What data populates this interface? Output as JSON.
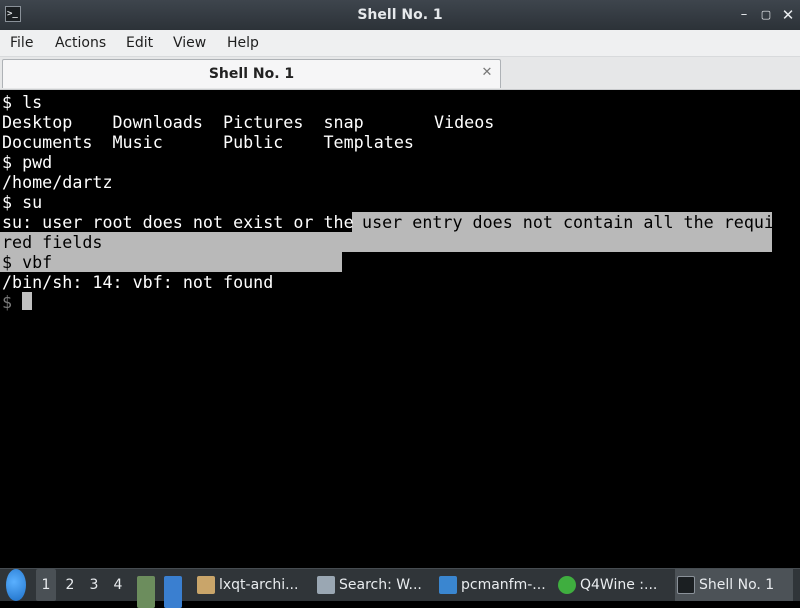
{
  "window": {
    "title": "Shell No. 1",
    "controls": {
      "minimize": "–",
      "maximize": "▢",
      "close": "✕"
    }
  },
  "menubar": {
    "items": [
      "File",
      "Actions",
      "Edit",
      "View",
      "Help"
    ]
  },
  "tabs": [
    {
      "label": "Shell No. 1",
      "active": true,
      "close": "✕"
    }
  ],
  "terminal": {
    "lines": [
      "$ ls",
      "Desktop    Downloads  Pictures  snap       Videos",
      "Documents  Music      Public    Templates",
      "$ pwd",
      "/home/dartz",
      "$ su",
      "su: user root does not exist or the",
      "red fields",
      "$ vbf",
      "/bin/sh: 14: vbf: not found",
      "$ "
    ],
    "selected_line_tail": " user entry does not contain all the requi",
    "prompt_cursor": "block"
  },
  "taskbar": {
    "desktops": [
      "1",
      "2",
      "3",
      "4"
    ],
    "active_desktop": "1",
    "windows": [
      {
        "label": "lxqt-archi...",
        "icon": "archive-icon",
        "color": "#c9a56a"
      },
      {
        "label": "Search: W...",
        "icon": "search-bag-icon",
        "color": "#9aa7b3"
      },
      {
        "label": "pcmanfm-...",
        "icon": "folder-icon",
        "color": "#3a86d0"
      },
      {
        "label": "Q4Wine :...",
        "icon": "wine-icon",
        "color": "#3fae3f"
      },
      {
        "label": "Shell No. 1",
        "icon": "terminal-icon",
        "color": "#1b1f22",
        "active": true
      }
    ]
  },
  "colors": {
    "titlebar": "#353b41",
    "menubar": "#eff0f1",
    "terminal_bg": "#000000",
    "terminal_fg": "#ffffff",
    "selection": "#b9b9b9",
    "taskbar": "#303539"
  }
}
